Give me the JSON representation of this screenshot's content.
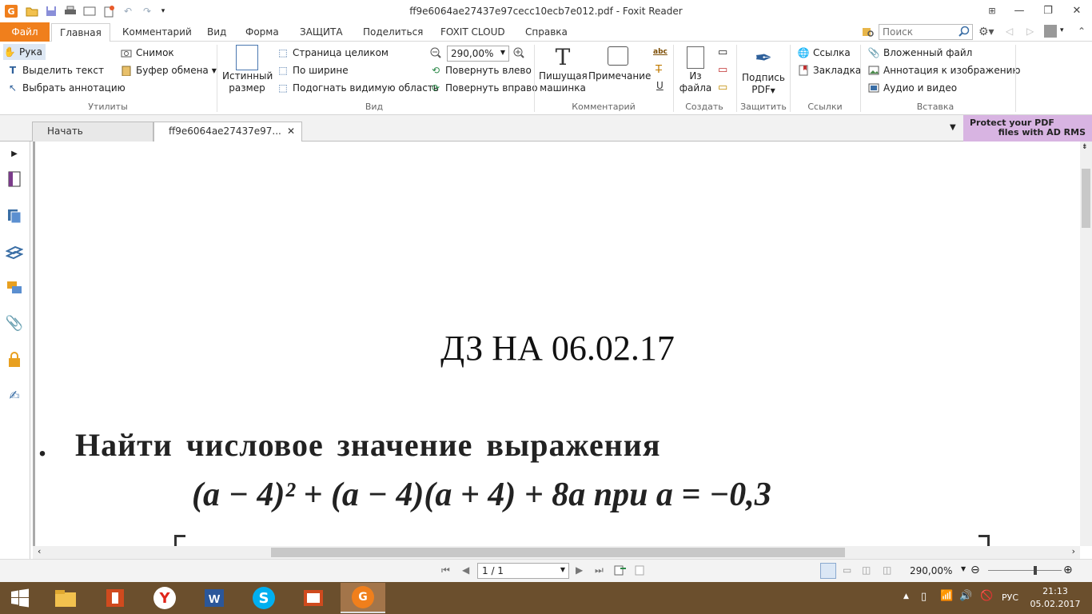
{
  "window": {
    "title": "ff9e6064ae27437e97cecc10ecb7e012.pdf - Foxit Reader"
  },
  "menu": {
    "file": "Файл",
    "home": "Главная",
    "comment": "Комментарий",
    "view": "Вид",
    "form": "Форма",
    "protect": "ЗАЩИТА",
    "share": "Поделиться",
    "cloud": "FOXIT CLOUD",
    "help": "Справка"
  },
  "search": {
    "placeholder": "Поиск"
  },
  "ribbon": {
    "hand": "Рука",
    "select_text": "Выделить текст",
    "select_annot": "Выбрать аннотацию",
    "snapshot": "Снимок",
    "clipboard": "Буфер обмена",
    "utilities_group": "Утилиты",
    "actual_size_1": "Истинный",
    "actual_size_2": "размер",
    "fit_page": "Страница целиком",
    "fit_width": "По ширине",
    "fit_visible": "Подогнать видимую область",
    "zoom_value": "290,00%",
    "rotate_left": "Повернуть влево",
    "rotate_right": "Повернуть вправо",
    "view_group": "Вид",
    "typewriter_1": "Пишущая",
    "typewriter_2": "машинка",
    "note": "Примечание",
    "abc": "abc",
    "comment_group": "Комментарий",
    "from_file_1": "Из",
    "from_file_2": "файла",
    "create_group": "Создать",
    "sign_1": "Подпись",
    "sign_2": "PDF",
    "protect_group": "Защитить",
    "link": "Ссылка",
    "bookmark": "Закладка",
    "links_group": "Ссылки",
    "attached_file": "Вложенный файл",
    "image_annot": "Аннотация к изображению",
    "audio_video": "Аудио и видео",
    "insert_group": "Вставка"
  },
  "tabs": {
    "start": "Начать",
    "doc": "ff9e6064ae27437e97..."
  },
  "promo": {
    "line1": "Protect your PDF",
    "line2": "files with AD RMS"
  },
  "document": {
    "heading": "ДЗ НА 06.02.17",
    "task_bullet": ".",
    "task_text": "Найти числовое значение выражения",
    "expression": "(a − 4)² + (a − 4)(a + 4) + 8a  при  a = −0,3"
  },
  "status": {
    "page": "1 / 1",
    "zoom": "290,00%"
  },
  "taskbar": {
    "lang": "РУС",
    "time": "21:13",
    "date": "05.02.2017"
  }
}
